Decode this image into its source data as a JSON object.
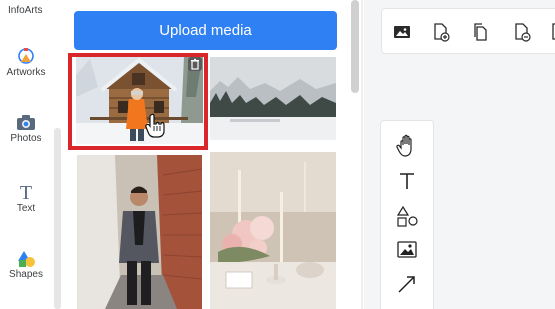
{
  "app": {
    "brand": "InfoArts"
  },
  "sidebar": {
    "items": [
      {
        "label": "Artworks",
        "icon": "artworks-icon"
      },
      {
        "label": "Photos",
        "icon": "camera-icon"
      },
      {
        "label": "Text",
        "icon": "text-icon"
      },
      {
        "label": "Shapes",
        "icon": "shapes-icon"
      }
    ]
  },
  "media": {
    "upload_label": "Upload media",
    "photos": [
      {
        "name": "woman-orange-jacket-cabin",
        "selected": true
      },
      {
        "name": "snowy-forest-lake"
      },
      {
        "name": "man-in-alley"
      },
      {
        "name": "wedding-table-flowers"
      }
    ]
  },
  "toolbar": {
    "icons": [
      "image-icon",
      "add-page-icon",
      "duplicate-page-icon",
      "delete-page-icon"
    ]
  },
  "tools": {
    "icons": [
      "hand-icon",
      "text-tool-icon",
      "shapes-tool-icon",
      "image-tool-icon",
      "arrow-tool-icon"
    ]
  },
  "colors": {
    "accent": "#2f80f2",
    "selection": "#d9262a"
  }
}
